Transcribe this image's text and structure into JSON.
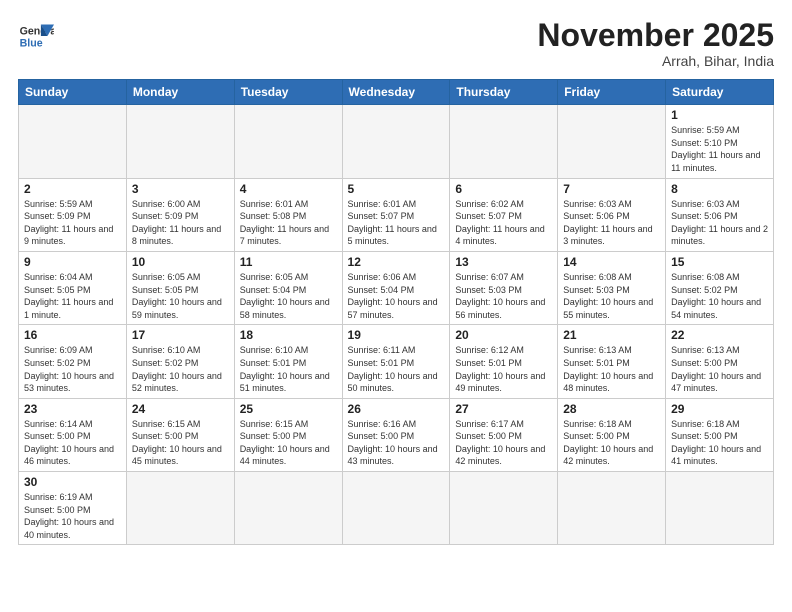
{
  "header": {
    "logo_general": "General",
    "logo_blue": "Blue",
    "month": "November 2025",
    "location": "Arrah, Bihar, India"
  },
  "weekdays": [
    "Sunday",
    "Monday",
    "Tuesday",
    "Wednesday",
    "Thursday",
    "Friday",
    "Saturday"
  ],
  "weeks": [
    [
      {
        "day": "",
        "info": ""
      },
      {
        "day": "",
        "info": ""
      },
      {
        "day": "",
        "info": ""
      },
      {
        "day": "",
        "info": ""
      },
      {
        "day": "",
        "info": ""
      },
      {
        "day": "",
        "info": ""
      },
      {
        "day": "1",
        "info": "Sunrise: 5:59 AM\nSunset: 5:10 PM\nDaylight: 11 hours and 11 minutes."
      }
    ],
    [
      {
        "day": "2",
        "info": "Sunrise: 5:59 AM\nSunset: 5:09 PM\nDaylight: 11 hours and 9 minutes."
      },
      {
        "day": "3",
        "info": "Sunrise: 6:00 AM\nSunset: 5:09 PM\nDaylight: 11 hours and 8 minutes."
      },
      {
        "day": "4",
        "info": "Sunrise: 6:01 AM\nSunset: 5:08 PM\nDaylight: 11 hours and 7 minutes."
      },
      {
        "day": "5",
        "info": "Sunrise: 6:01 AM\nSunset: 5:07 PM\nDaylight: 11 hours and 5 minutes."
      },
      {
        "day": "6",
        "info": "Sunrise: 6:02 AM\nSunset: 5:07 PM\nDaylight: 11 hours and 4 minutes."
      },
      {
        "day": "7",
        "info": "Sunrise: 6:03 AM\nSunset: 5:06 PM\nDaylight: 11 hours and 3 minutes."
      },
      {
        "day": "8",
        "info": "Sunrise: 6:03 AM\nSunset: 5:06 PM\nDaylight: 11 hours and 2 minutes."
      }
    ],
    [
      {
        "day": "9",
        "info": "Sunrise: 6:04 AM\nSunset: 5:05 PM\nDaylight: 11 hours and 1 minute."
      },
      {
        "day": "10",
        "info": "Sunrise: 6:05 AM\nSunset: 5:05 PM\nDaylight: 10 hours and 59 minutes."
      },
      {
        "day": "11",
        "info": "Sunrise: 6:05 AM\nSunset: 5:04 PM\nDaylight: 10 hours and 58 minutes."
      },
      {
        "day": "12",
        "info": "Sunrise: 6:06 AM\nSunset: 5:04 PM\nDaylight: 10 hours and 57 minutes."
      },
      {
        "day": "13",
        "info": "Sunrise: 6:07 AM\nSunset: 5:03 PM\nDaylight: 10 hours and 56 minutes."
      },
      {
        "day": "14",
        "info": "Sunrise: 6:08 AM\nSunset: 5:03 PM\nDaylight: 10 hours and 55 minutes."
      },
      {
        "day": "15",
        "info": "Sunrise: 6:08 AM\nSunset: 5:02 PM\nDaylight: 10 hours and 54 minutes."
      }
    ],
    [
      {
        "day": "16",
        "info": "Sunrise: 6:09 AM\nSunset: 5:02 PM\nDaylight: 10 hours and 53 minutes."
      },
      {
        "day": "17",
        "info": "Sunrise: 6:10 AM\nSunset: 5:02 PM\nDaylight: 10 hours and 52 minutes."
      },
      {
        "day": "18",
        "info": "Sunrise: 6:10 AM\nSunset: 5:01 PM\nDaylight: 10 hours and 51 minutes."
      },
      {
        "day": "19",
        "info": "Sunrise: 6:11 AM\nSunset: 5:01 PM\nDaylight: 10 hours and 50 minutes."
      },
      {
        "day": "20",
        "info": "Sunrise: 6:12 AM\nSunset: 5:01 PM\nDaylight: 10 hours and 49 minutes."
      },
      {
        "day": "21",
        "info": "Sunrise: 6:13 AM\nSunset: 5:01 PM\nDaylight: 10 hours and 48 minutes."
      },
      {
        "day": "22",
        "info": "Sunrise: 6:13 AM\nSunset: 5:00 PM\nDaylight: 10 hours and 47 minutes."
      }
    ],
    [
      {
        "day": "23",
        "info": "Sunrise: 6:14 AM\nSunset: 5:00 PM\nDaylight: 10 hours and 46 minutes."
      },
      {
        "day": "24",
        "info": "Sunrise: 6:15 AM\nSunset: 5:00 PM\nDaylight: 10 hours and 45 minutes."
      },
      {
        "day": "25",
        "info": "Sunrise: 6:15 AM\nSunset: 5:00 PM\nDaylight: 10 hours and 44 minutes."
      },
      {
        "day": "26",
        "info": "Sunrise: 6:16 AM\nSunset: 5:00 PM\nDaylight: 10 hours and 43 minutes."
      },
      {
        "day": "27",
        "info": "Sunrise: 6:17 AM\nSunset: 5:00 PM\nDaylight: 10 hours and 42 minutes."
      },
      {
        "day": "28",
        "info": "Sunrise: 6:18 AM\nSunset: 5:00 PM\nDaylight: 10 hours and 42 minutes."
      },
      {
        "day": "29",
        "info": "Sunrise: 6:18 AM\nSunset: 5:00 PM\nDaylight: 10 hours and 41 minutes."
      }
    ],
    [
      {
        "day": "30",
        "info": "Sunrise: 6:19 AM\nSunset: 5:00 PM\nDaylight: 10 hours and 40 minutes."
      },
      {
        "day": "",
        "info": ""
      },
      {
        "day": "",
        "info": ""
      },
      {
        "day": "",
        "info": ""
      },
      {
        "day": "",
        "info": ""
      },
      {
        "day": "",
        "info": ""
      },
      {
        "day": "",
        "info": ""
      }
    ]
  ]
}
